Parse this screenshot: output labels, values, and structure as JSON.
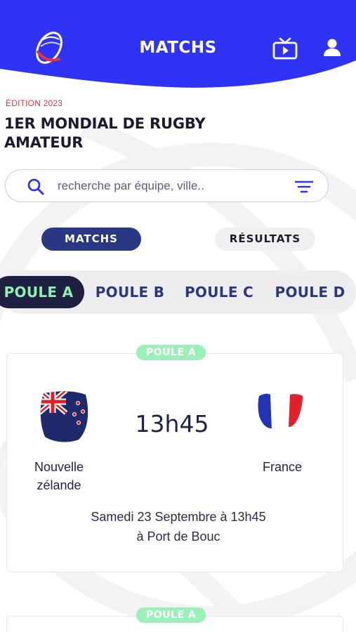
{
  "header": {
    "title": "MATCHS",
    "logo_icon": "rugby-ball-logo-icon",
    "tv_icon": "tv-play-icon",
    "user_icon": "user-icon",
    "brand_color": "#2f33f5"
  },
  "event": {
    "edition": "ÉDITION 2023",
    "title_line1": "1ER MONDIAL DE RUGBY",
    "title_line2": "AMATEUR"
  },
  "search": {
    "placeholder": "recherche par équipe, ville..",
    "value": ""
  },
  "toggles": {
    "matchs": "MATCHS",
    "resultats": "RÉSULTATS",
    "active": "matchs"
  },
  "pools": [
    {
      "label": "POULE A",
      "active": true
    },
    {
      "label": "POULE B",
      "active": false
    },
    {
      "label": "POULE C",
      "active": false
    },
    {
      "label": "POULE D",
      "active": false
    }
  ],
  "matches": [
    {
      "pool": "POULE A",
      "time": "13h45",
      "home": {
        "line1": "Nouvelle",
        "line2": "zélande",
        "flag": "new-zealand-flag-icon"
      },
      "away": {
        "name": "France",
        "flag": "france-flag-icon"
      },
      "date": "Samedi 23 Septembre à 13h45",
      "venue": "à Port de Bouc"
    },
    {
      "pool": "POULE A"
    }
  ]
}
